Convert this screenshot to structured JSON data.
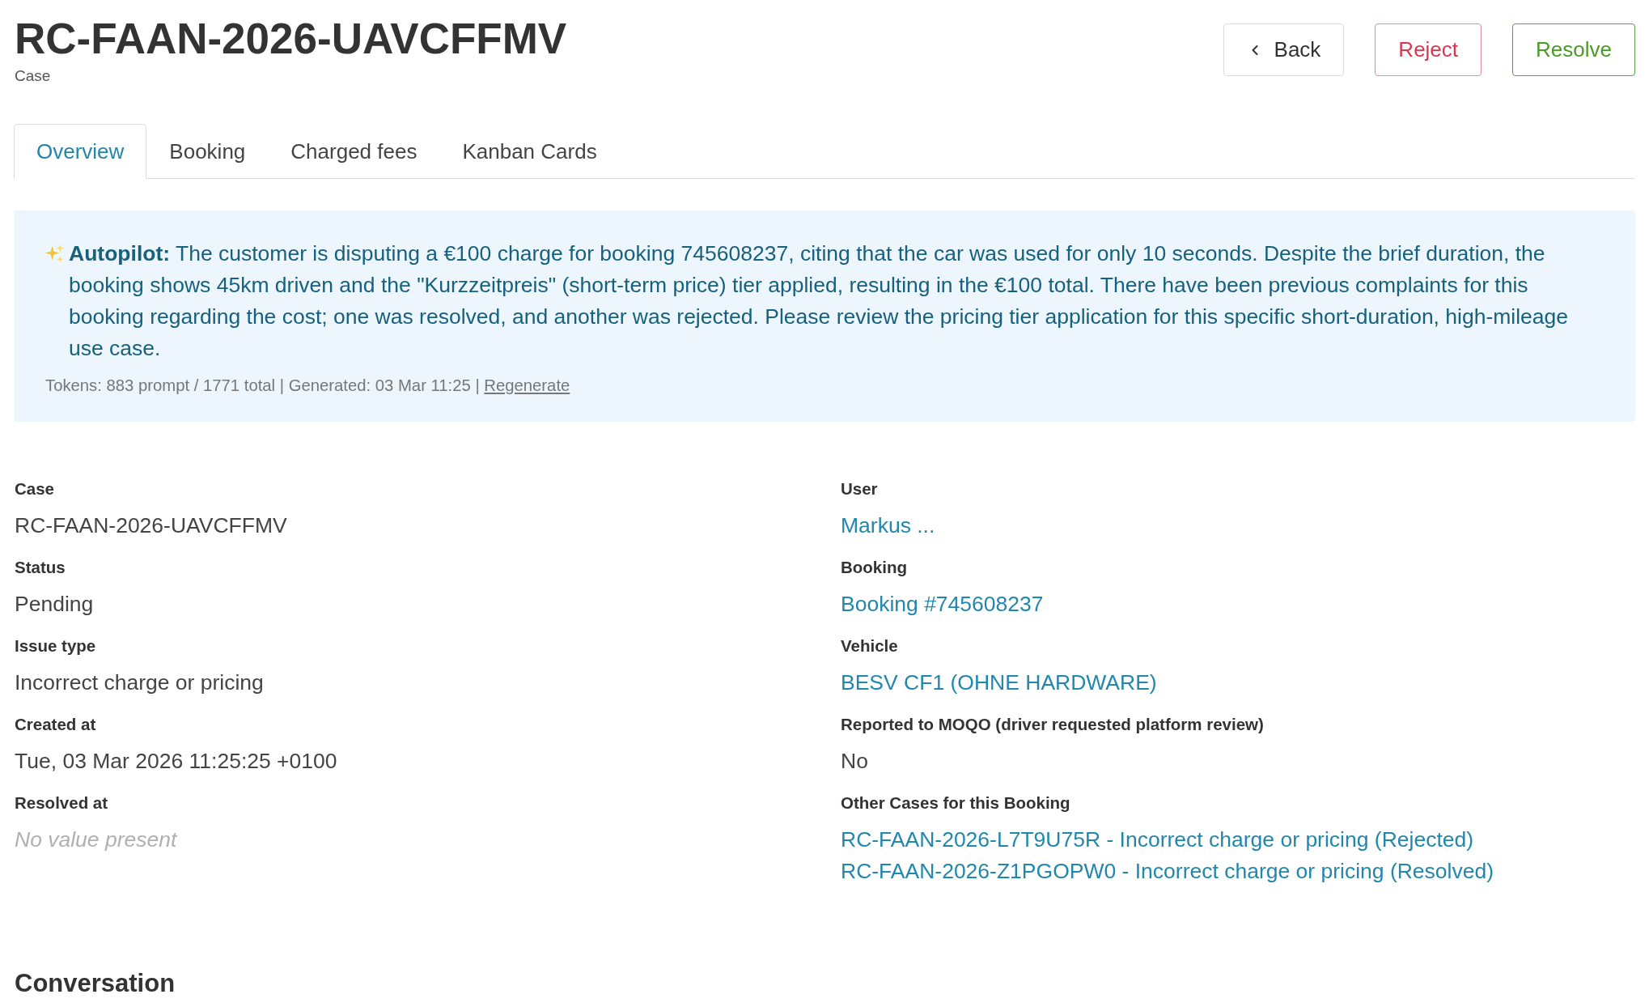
{
  "header": {
    "title": "RC-FAAN-2026-UAVCFFMV",
    "subtitle": "Case"
  },
  "actions": [
    {
      "label": "Back",
      "kind": "back"
    },
    {
      "label": "Reject",
      "kind": "reject"
    },
    {
      "label": "Resolve",
      "kind": "resolve"
    }
  ],
  "tabs": [
    {
      "label": "Overview",
      "selected": true
    },
    {
      "label": "Booking",
      "selected": false
    },
    {
      "label": "Charged fees",
      "selected": false
    },
    {
      "label": "Kanban Cards",
      "selected": false
    }
  ],
  "autopilot": {
    "summary": "**Autopilot:** The customer is disputing a €100 charge for booking 745608237, citing that the car was used for only 10 seconds. Despite the brief duration, the booking shows 45km driven and the \"Kurzzeitpreis\" (short-term price) tier applied, resulting in the €100 total. There have been previous complaints for this booking regarding the cost; one was resolved, and another was rejected. Please review the pricing tier application for this specific short-duration, high-mileage use case.",
    "meta": "Tokens: 883 prompt / 1771 total | Generated: 03 Mar 11:25 |",
    "action": "Regenerate"
  },
  "details": {
    "left": [
      {
        "label": "Case",
        "kind": "text",
        "value": "RC-FAAN-2026-UAVCFFMV"
      },
      {
        "label": "Status",
        "kind": "text",
        "value": "Pending"
      },
      {
        "label": "Issue type",
        "kind": "text",
        "value": "Incorrect charge or pricing"
      },
      {
        "label": "Created at",
        "kind": "text",
        "value": "Tue, 03 Mar 2026 11:25:25 +0100"
      },
      {
        "label": "Resolved at",
        "kind": "empty",
        "value": "No value present"
      }
    ],
    "right": [
      {
        "label": "User",
        "kind": "link",
        "value": "Markus ..."
      },
      {
        "label": "Booking",
        "kind": "link",
        "value": "Booking #745608237"
      },
      {
        "label": "Vehicle",
        "kind": "link",
        "value": "BESV CF1 (OHNE HARDWARE)"
      },
      {
        "label": "Reported to MOQO (driver requested platform review)",
        "kind": "text",
        "value": "No"
      },
      {
        "label": "Other Cases for this Booking",
        "kind": "links",
        "values": [
          "RC-FAAN-2026-L7T9U75R - Incorrect charge or pricing (Rejected)",
          "RC-FAAN-2026-Z1PGOPW0 - Incorrect charge or pricing (Resolved)"
        ]
      }
    ]
  },
  "conversation": {
    "title": "Conversation"
  }
}
